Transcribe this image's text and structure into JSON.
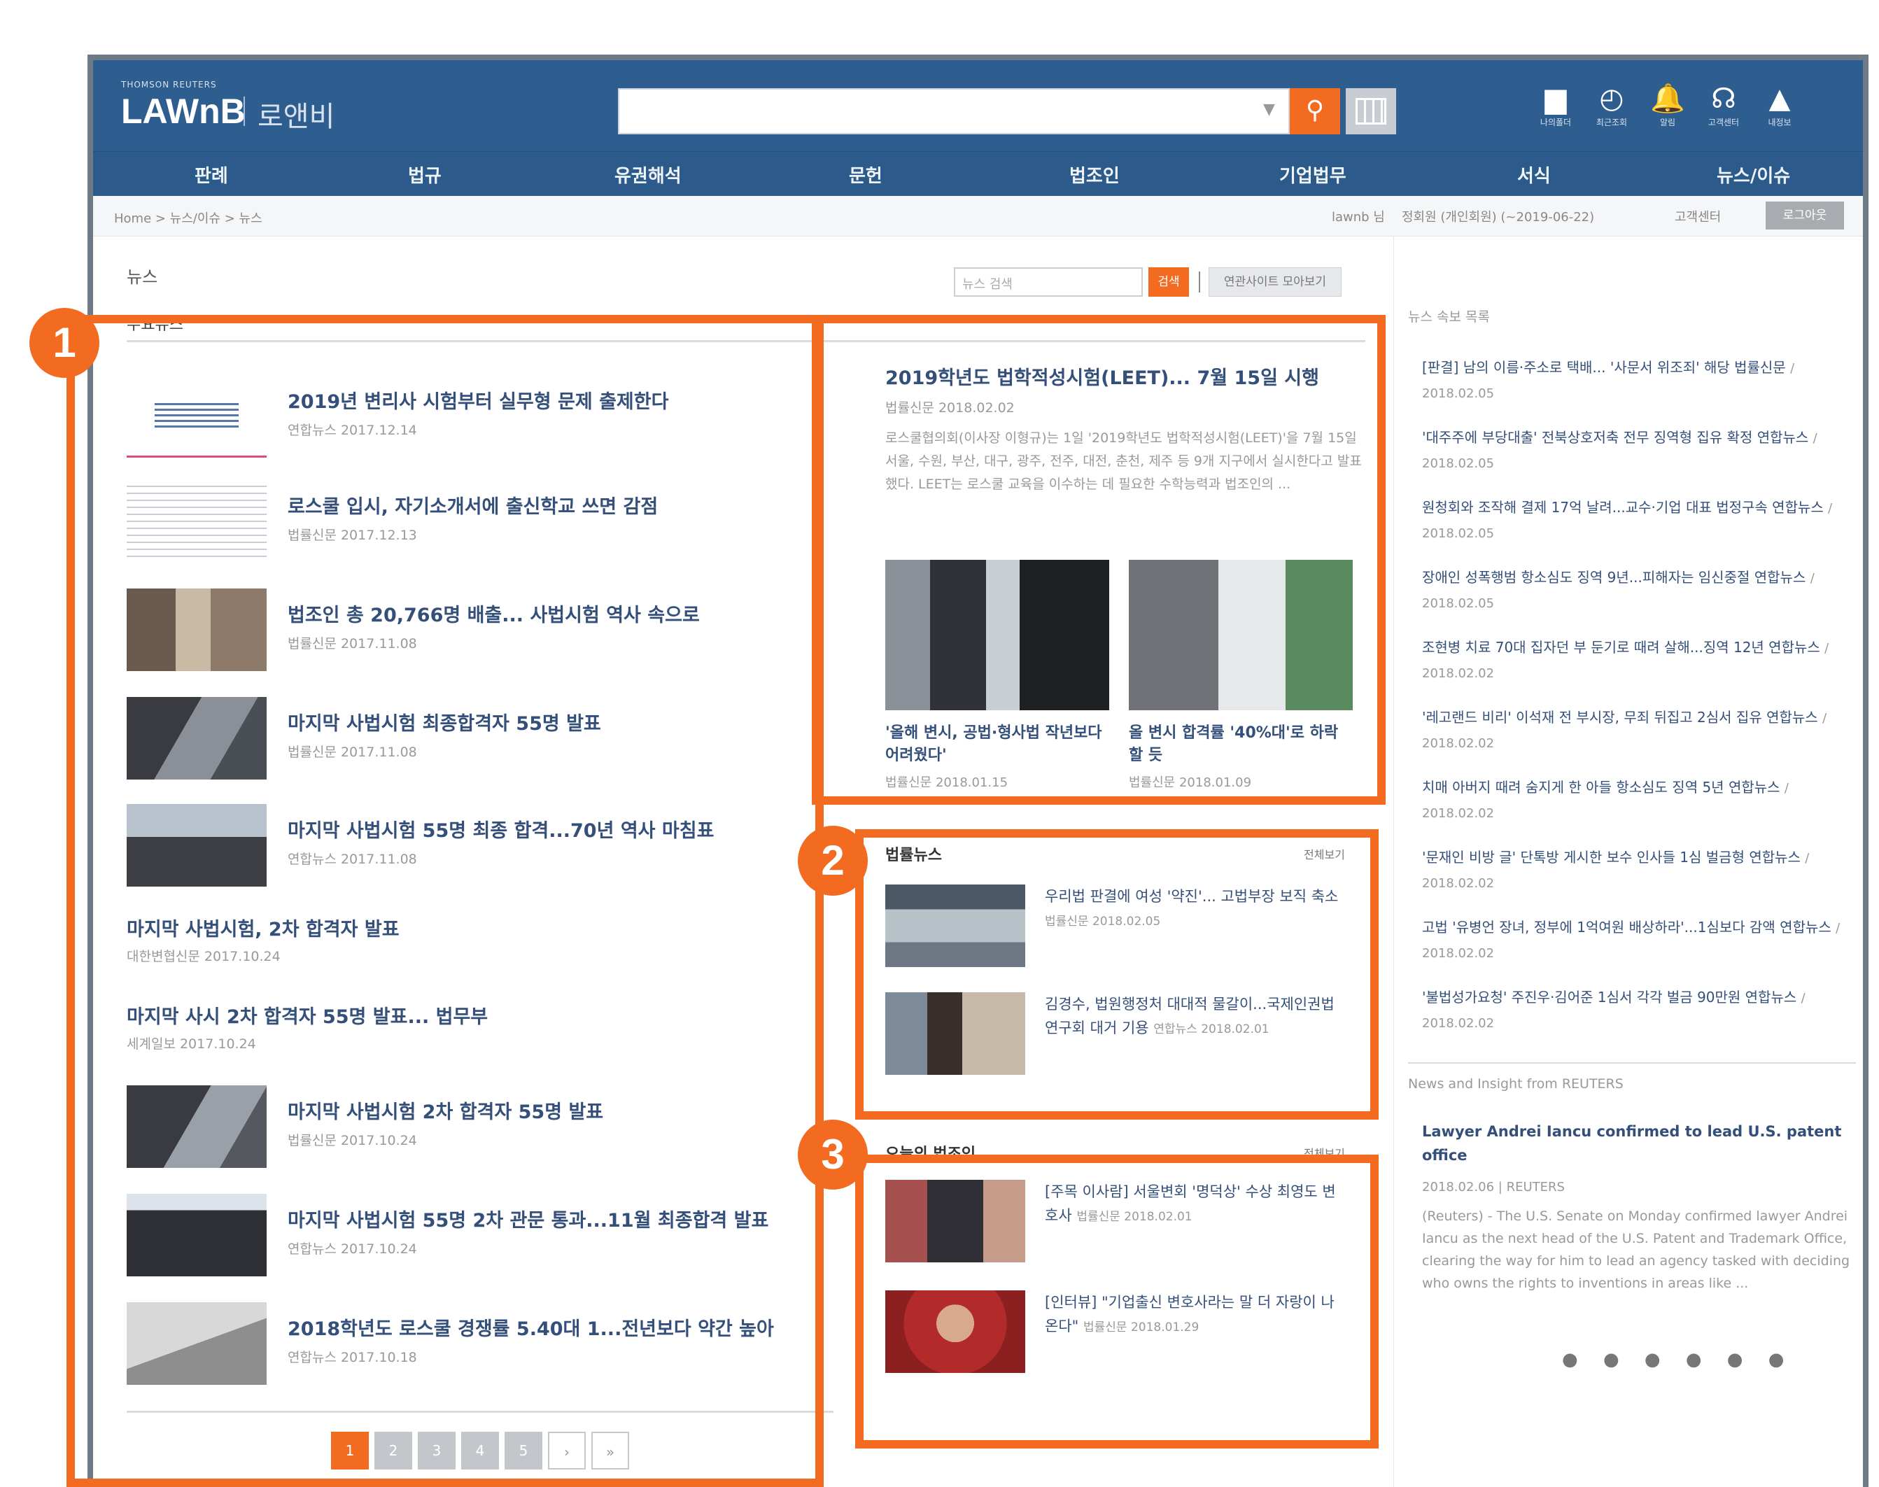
{
  "header": {
    "logo_small": "THOMSON REUTERS",
    "logo": "LAWnB",
    "logo_korean": "로앤비",
    "icons": [
      {
        "name": "folder-icon",
        "glyph": "▆",
        "label": "나의폴더"
      },
      {
        "name": "history-icon",
        "glyph": "◴",
        "label": "최근조회"
      },
      {
        "name": "bell-icon",
        "glyph": "🔔",
        "label": "알림"
      },
      {
        "name": "headset-icon",
        "glyph": "☊",
        "label": "고객센터"
      },
      {
        "name": "user-icon",
        "glyph": "▲",
        "label": "내정보"
      }
    ]
  },
  "nav": [
    "판례",
    "법규",
    "유권해석",
    "문헌",
    "법조인",
    "기업법무",
    "서식",
    "뉴스/이슈"
  ],
  "breadcrumb": "Home > 뉴스/이슈 > 뉴스",
  "topbar": {
    "user": "lawnb 님",
    "membership": "정회원 (개인회원) (~2019-06-22)",
    "support": "고객센터",
    "logout": "로그아웃"
  },
  "page_title": "뉴스",
  "sub_title": "주요뉴스",
  "news_search": {
    "placeholder": "뉴스 검색",
    "button": "검색",
    "related": "연관사이트 모아보기"
  },
  "main_list": [
    {
      "title": "2019년 변리사 시험부터 실무형 문제 출제한다",
      "source": "연합뉴스 2017.12.14"
    },
    {
      "title": "로스쿨 입시, 자기소개서에 출신학교 쓰면 감점",
      "source": "법률신문 2017.12.13"
    },
    {
      "title": "법조인 총 20,766명 배출... 사법시험 역사 속으로",
      "source": "법률신문 2017.11.08"
    },
    {
      "title": "마지막 사법시험 최종합격자 55명 발표",
      "source": "법률신문 2017.11.08"
    },
    {
      "title": "마지막 사법시험 55명 최종 합격...70년 역사 마침표",
      "source": "연합뉴스 2017.11.08"
    }
  ],
  "text_list": [
    {
      "title": "마지막 사법시험, 2차 합격자 발표",
      "source": "대한변협신문 2017.10.24"
    },
    {
      "title": "마지막 사시 2차 합격자 55명 발표... 법무부",
      "source": "세계일보 2017.10.24"
    }
  ],
  "main_list2": [
    {
      "title": "마지막 사법시험 2차 합격자 55명 발표",
      "source": "법률신문 2017.10.24"
    },
    {
      "title": "마지막 사법시험 55명 2차 관문 통과...11월 최종합격 발표",
      "source": "연합뉴스 2017.10.24"
    },
    {
      "title": "2018학년도 로스쿨 경쟁률 5.40대 1...전년보다 약간 높아",
      "source": "연합뉴스 2017.10.18"
    }
  ],
  "pagination": {
    "pages": [
      "1",
      "2",
      "3",
      "4",
      "5"
    ],
    "next": "›",
    "last": "»"
  },
  "featured": {
    "title": "2019학년도 법학적성시험(LEET)... 7월 15일 시행",
    "source": "법률신문 2018.02.02",
    "body": "로스쿨협의회(이사장 이형규)는 1일 '2019학년도 법학적성시험(LEET)'을 7월 15일 서울, 수원, 부산, 대구, 광주, 전주, 대전, 춘천, 제주 등 9개 지구에서 실시한다고 발표했다. LEET는 로스쿨 교육을 이수하는 데 필요한 수학능력과 법조인의 ...",
    "captions": [
      {
        "title": "'올해 변시, 공법·형사법 작년보다 어려웠다'",
        "source": "법률신문 2018.01.15"
      },
      {
        "title": "올 변시 합격률 '40%대'로 하락할 듯",
        "source": "법률신문 2018.01.09"
      }
    ]
  },
  "law_news": {
    "head": "법률뉴스",
    "more": "전체보기",
    "items": [
      {
        "text": "우리법 판결에 여성 '약진'... 고법부장 보직 축소",
        "source": "법률신문 2018.02.05"
      },
      {
        "text": "김경수, 법원행정처 대대적 물갈이...국제인권법연구회 대거 기용",
        "source": "연합뉴스 2018.02.01"
      }
    ]
  },
  "today_lawyer": {
    "head": "오늘의 법조인",
    "more": "전체보기",
    "items": [
      {
        "text": "[주목 이사람] 서울변회 '명덕상' 수상 최영도 변호사",
        "source": "법률신문 2018.02.01"
      },
      {
        "text": "[인터뷰] \"기업출신 변호사라는 말 더 자랑이 나온다\"",
        "source": "법률신문 2018.01.29"
      }
    ]
  },
  "rightcol": {
    "head1": "뉴스 속보 목록",
    "items": [
      {
        "text": "[판결] 남의 이름·주소로 택배... '사문서 위조죄' 해당 법률신문",
        "source": "/ 2018.02.05"
      },
      {
        "text": "'대주주에 부당대출' 전북상호저축 전무 징역형 집유 확정 연합뉴스",
        "source": "/ 2018.02.05"
      },
      {
        "text": "원청회와 조작해 결제 17억 날려...교수·기업 대표 법정구속 연합뉴스",
        "source": "/ 2018.02.05"
      },
      {
        "text": "장애인 성폭행범 항소심도 징역 9년...피해자는 임신중절 연합뉴스",
        "source": "/ 2018.02.05"
      },
      {
        "text": "조현병 치료 70대 집자던 부 둔기로 때려 살해...징역 12년 연합뉴스",
        "source": "/ 2018.02.02"
      },
      {
        "text": "'레고랜드 비리' 이석재 전 부시장, 무죄 뒤집고 2심서 집유 연합뉴스",
        "source": "/ 2018.02.02"
      },
      {
        "text": "치매 아버지 때려 숨지게 한 아들 항소심도 징역 5년 연합뉴스",
        "source": "/ 2018.02.02"
      },
      {
        "text": "'문재인 비방 글' 단톡방 게시한 보수 인사들 1심 벌금형 연합뉴스",
        "source": "/ 2018.02.02"
      },
      {
        "text": "고법 '유병언 장녀, 정부에 1억여원 배상하라'...1심보다 감액 연합뉴스",
        "source": "/ 2018.02.02"
      },
      {
        "text": "'불법성가요청' 주진우·김어준 1심서 각각 벌금 90만원 연합뉴스",
        "source": "/ 2018.02.02"
      }
    ],
    "head2": "News and Insight from REUTERS",
    "en_title": "Lawyer Andrei Iancu confirmed to lead U.S. patent office",
    "en_meta": "2018.02.06 | REUTERS",
    "en_body": "(Reuters) - The U.S. Senate on Monday confirmed lawyer Andrei Iancu as the next head of the U.S. Patent and Trademark Office, clearing the way for him to lead an agency tasked with deciding who owns the rights to inventions in areas like ...",
    "dots": "● ● ● ● ● ●"
  },
  "callouts": [
    "1",
    "2",
    "3"
  ],
  "colors": {
    "header": "#2e5d8f",
    "accent": "#f26b21",
    "link": "#34507a"
  }
}
